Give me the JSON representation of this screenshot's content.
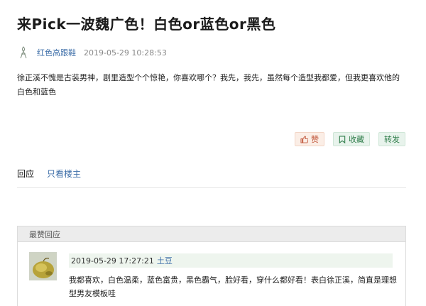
{
  "post": {
    "title": "来Pick一波魏广色！白色or蓝色or黑色",
    "author": "红色高跟鞋",
    "time": "2019-05-29 10:28:53",
    "body": "徐正溪不愧是古装男神，剧里造型个个惊艳，你喜欢哪个？我先，我先，虽然每个造型我都爱，但我更喜欢他的白色和蓝色"
  },
  "actions": {
    "like": "赞",
    "favorite": "收藏",
    "share": "转发"
  },
  "tabs": {
    "reply": "回应",
    "only_op": "只看楼主"
  },
  "best_replies": {
    "header": "最赞回应",
    "items": [
      {
        "time": "2019-05-29 17:27:21",
        "user": "土豆",
        "text": "我都喜欢，白色温柔，蓝色富贵，黑色霸气，脸好看，穿什么都好看！表白徐正溪，简直是理想型男友模板哇"
      }
    ]
  },
  "colors": {
    "link": "#3d6ea8",
    "like": "#c0553a",
    "green": "#2f7d4a"
  }
}
